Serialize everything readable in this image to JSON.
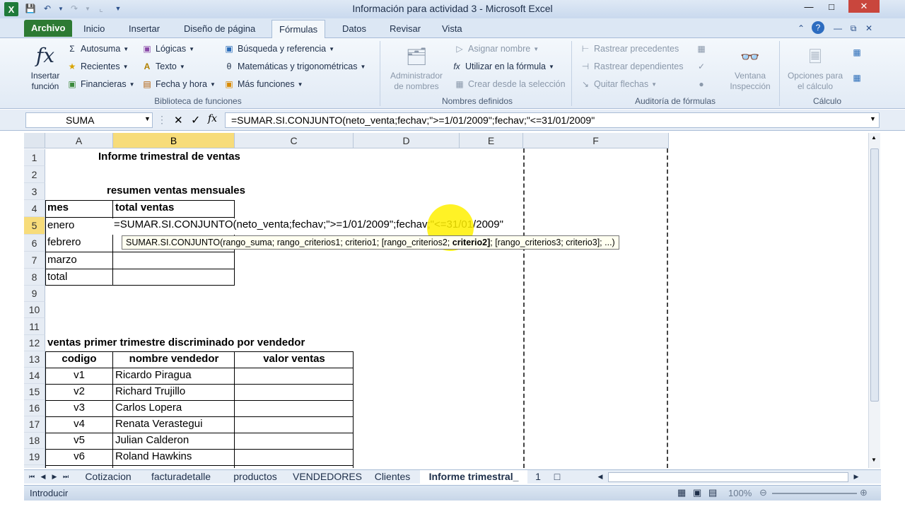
{
  "window": {
    "title": "Información para actividad 3  -  Microsoft Excel",
    "app_icon": "X"
  },
  "tabs": [
    "Archivo",
    "Inicio",
    "Insertar",
    "Diseño de página",
    "Fórmulas",
    "Datos",
    "Revisar",
    "Vista"
  ],
  "ribbon": {
    "insert_function": "Insertar\nfunción",
    "insert_function_1": "Insertar",
    "insert_function_2": "función",
    "lib": {
      "autosuma": "Autosuma",
      "recientes": "Recientes",
      "financieras": "Financieras",
      "logicas": "Lógicas",
      "texto": "Texto",
      "fecha": "Fecha y hora",
      "busqueda": "Búsqueda y referencia",
      "matematicas": "Matemáticas y trigonométricas",
      "mas": "Más funciones",
      "label": "Biblioteca de funciones"
    },
    "names": {
      "admin_1": "Administrador",
      "admin_2": "de nombres",
      "asignar": "Asignar nombre",
      "utilizar": "Utilizar en la fórmula",
      "crear": "Crear desde la selección",
      "label": "Nombres definidos"
    },
    "audit": {
      "precedentes": "Rastrear precedentes",
      "dependientes": "Rastrear dependientes",
      "quitar": "Quitar flechas",
      "ventana_1": "Ventana",
      "ventana_2": "Inspección",
      "label": "Auditoría de fórmulas"
    },
    "calc": {
      "opciones_1": "Opciones para",
      "opciones_2": "el cálculo",
      "label": "Cálculo"
    }
  },
  "formula_bar": {
    "name_box": "SUMA",
    "formula": "=SUMAR.SI.CONJUNTO(neto_venta;fechav;\">=1/01/2009\";fechav;\"<=31/01/2009\""
  },
  "columns": [
    "A",
    "B",
    "C",
    "D",
    "E",
    "F"
  ],
  "rows": [
    "1",
    "2",
    "3",
    "4",
    "5",
    "6",
    "7",
    "8",
    "9",
    "10",
    "11",
    "12",
    "13",
    "14",
    "15",
    "16",
    "17",
    "18",
    "19"
  ],
  "sheet": {
    "title": "Informe trimestral de ventas",
    "subtitle": "resumen ventas mensuales",
    "h_mes": "mes",
    "h_total": "total ventas",
    "months": [
      "enero",
      "febrero",
      "marzo",
      "total"
    ],
    "editing": "=SUMAR.SI.CONJUNTO(neto_venta;fechav;\">=1/01/2009\";fechav;\"<=31/01/2009\"",
    "section2": "ventas primer trimestre discriminado por vendedor",
    "h_codigo": "codigo",
    "h_nombre": "nombre vendedor",
    "h_valor": "valor ventas",
    "sellers": [
      {
        "code": "v1",
        "name": "Ricardo Piragua"
      },
      {
        "code": "v2",
        "name": "Richard Trujillo"
      },
      {
        "code": "v3",
        "name": "Carlos Lopera"
      },
      {
        "code": "v4",
        "name": "Renata Verastegui"
      },
      {
        "code": "v5",
        "name": "Julian Calderon"
      },
      {
        "code": "v6",
        "name": "Roland Hawkins"
      }
    ]
  },
  "tooltip": {
    "fn": "SUMAR.SI.CONJUNTO(rango_suma; rango_criterios1; criterio1; [rango_criterios2; ",
    "bold": "criterio2]",
    "rest": "; [rango_criterios3; criterio3]; ...)"
  },
  "sheet_tabs": [
    "Cotizacion",
    "facturadetalle",
    "productos",
    "VENDEDORES",
    "Clientes",
    "Informe trimestral_",
    "1"
  ],
  "status": {
    "mode": "Introducir",
    "zoom": "100%"
  }
}
